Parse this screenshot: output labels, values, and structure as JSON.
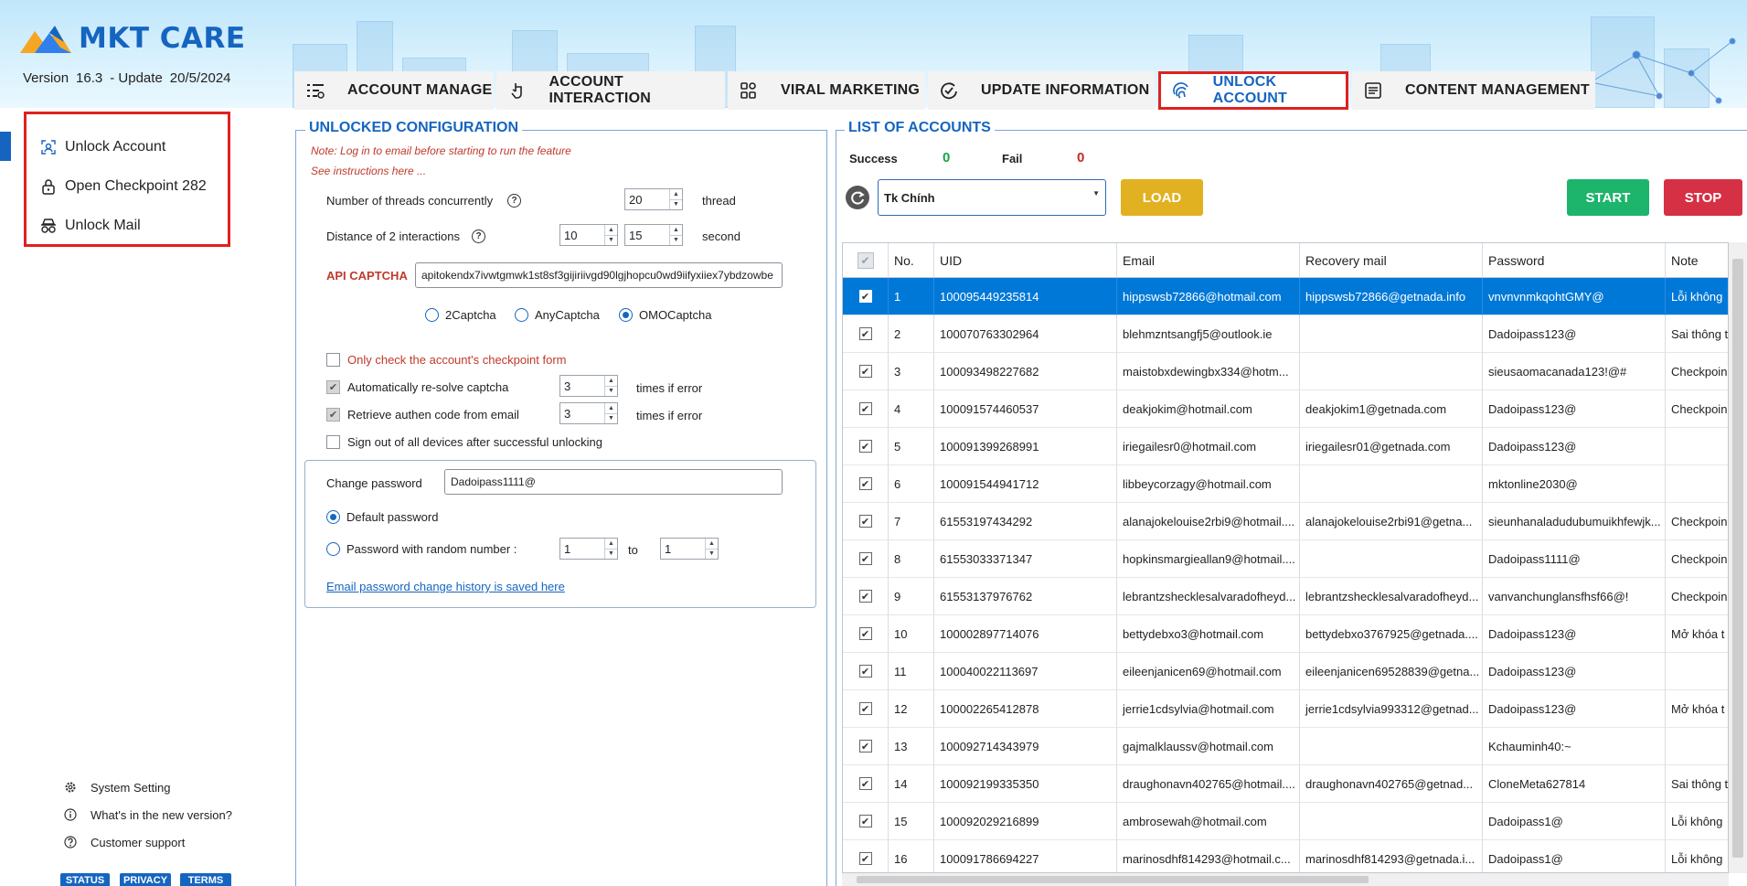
{
  "app": {
    "name": "MKT CARE",
    "version_label": "Version",
    "version": "16.3",
    "update_label": "- Update",
    "update_date": "20/5/2024"
  },
  "tabs": [
    {
      "label": "ACCOUNT MANAGE",
      "icon": "list-settings-icon"
    },
    {
      "label": "ACCOUNT INTERACTION",
      "icon": "hand-pointer-icon"
    },
    {
      "label": "VIRAL MARKETING",
      "icon": "grid-apps-icon"
    },
    {
      "label": "UPDATE INFORMATION",
      "icon": "refresh-check-icon"
    },
    {
      "label": "UNLOCK ACCOUNT",
      "icon": "fingerprint-icon",
      "active": true
    },
    {
      "label": "CONTENT MANAGEMENT",
      "icon": "document-icon"
    }
  ],
  "sidebar": {
    "items": [
      {
        "label": "Unlock Account",
        "icon": "scan-face-icon"
      },
      {
        "label": "Open Checkpoint 282",
        "icon": "lock-icon"
      },
      {
        "label": "Unlock Mail",
        "icon": "mail-spy-icon"
      }
    ],
    "footer": [
      {
        "label": "System Setting",
        "icon": "gear-icon"
      },
      {
        "label": "What's in the new version?",
        "icon": "info-icon"
      },
      {
        "label": "Customer support",
        "icon": "help-icon"
      }
    ],
    "footer_buttons": [
      "STATUS",
      "PRIVACY",
      "TERMS"
    ]
  },
  "config": {
    "title": "UNLOCKED CONFIGURATION",
    "note1": "Note: Log in to email before starting to run the feature",
    "note2": "See instructions here ...",
    "threads_label": "Number of threads concurrently",
    "threads_value": "20",
    "threads_unit": "thread",
    "distance_label": "Distance of 2 interactions",
    "distance_from": "10",
    "distance_to": "15",
    "distance_unit": "second",
    "api_label": "API CAPTCHA",
    "api_value": "apitokendx7ivwtgmwk1st8sf3gijiriivgd90lgjhopcu0wd9iifyxiiex7ybdzowbe",
    "captcha_options": [
      "2Captcha",
      "AnyCaptcha",
      "OMOCaptcha"
    ],
    "captcha_selected": "OMOCaptcha",
    "only_check_label": "Only check the account's checkpoint form",
    "resolve_label": "Automatically re-solve captcha",
    "resolve_value": "3",
    "resolve_unit": "times if error",
    "retrieve_label": "Retrieve authen code from email",
    "retrieve_value": "3",
    "retrieve_unit": "times if error",
    "signout_label": "Sign out of all devices after successful unlocking",
    "change_password_label": "Change password",
    "change_password_value": "Dadoipass1111@",
    "default_password_label": "Default password",
    "random_password_label": "Password with random number :",
    "random_from": "1",
    "random_to_label": "to",
    "random_to": "1",
    "history_link": "Email password change history is saved here"
  },
  "accounts": {
    "title": "LIST OF ACCOUNTS",
    "success_label": "Success",
    "success_value": "0",
    "fail_label": "Fail",
    "fail_value": "0",
    "combo_value": "Tk Chính",
    "load_label": "LOAD",
    "start_label": "START",
    "stop_label": "STOP",
    "colors": {
      "success": "#1aa34a",
      "fail": "#c62828",
      "load": "#e2b121",
      "start": "#1db46b",
      "stop": "#d63045",
      "accent": "#1565c0"
    },
    "columns": [
      "No.",
      "UID",
      "Email",
      "Recovery mail",
      "Password",
      "Note"
    ],
    "rows": [
      {
        "no": "1",
        "uid": "100095449235814",
        "email": "hippswsb72866@hotmail.com",
        "recovery": "hippswsb72866@getnada.info",
        "password": "vnvnvnmkqohtGMY@",
        "note": "Lỗi không"
      },
      {
        "no": "2",
        "uid": "100070763302964",
        "email": "blehmzntsangfj5@outlook.ie",
        "recovery": "",
        "password": "Dadoipass123@",
        "note": "Sai thông t"
      },
      {
        "no": "3",
        "uid": "100093498227682",
        "email": "maistobxdewingbx334@hotm...",
        "recovery": "",
        "password": "sieusaomacanada123!@#",
        "note": "Checkpoin"
      },
      {
        "no": "4",
        "uid": "100091574460537",
        "email": "deakjokim@hotmail.com",
        "recovery": "deakjokim1@getnada.com",
        "password": "Dadoipass123@",
        "note": "Checkpoin"
      },
      {
        "no": "5",
        "uid": "100091399268991",
        "email": "iriegailesr0@hotmail.com",
        "recovery": "iriegailesr01@getnada.com",
        "password": "Dadoipass123@",
        "note": ""
      },
      {
        "no": "6",
        "uid": "100091544941712",
        "email": "libbeycorzagy@hotmail.com",
        "recovery": "",
        "password": "mktonline2030@",
        "note": ""
      },
      {
        "no": "7",
        "uid": "61553197434292",
        "email": "alanajokelouise2rbi9@hotmail....",
        "recovery": "alanajokelouise2rbi91@getna...",
        "password": "sieunhanaladudubumuikhfewjk...",
        "note": "Checkpoin"
      },
      {
        "no": "8",
        "uid": "61553033371347",
        "email": "hopkinsmargieallan9@hotmail....",
        "recovery": "",
        "password": "Dadoipass1111@",
        "note": "Checkpoin"
      },
      {
        "no": "9",
        "uid": "61553137976762",
        "email": "lebrantzshecklesalvaradofheyd...",
        "recovery": "lebrantzshecklesalvaradofheyd...",
        "password": "vanvanchunglansfhsf66@!",
        "note": "Checkpoin"
      },
      {
        "no": "10",
        "uid": "100002897714076",
        "email": "bettydebxo3@hotmail.com",
        "recovery": "bettydebxo3767925@getnada....",
        "password": "Dadoipass123@",
        "note": "Mở khóa t"
      },
      {
        "no": "11",
        "uid": "100040022113697",
        "email": "eileenjanicen69@hotmail.com",
        "recovery": "eileenjanicen69528839@getna...",
        "password": "Dadoipass123@",
        "note": ""
      },
      {
        "no": "12",
        "uid": "100002265412878",
        "email": "jerrie1cdsylvia@hotmail.com",
        "recovery": "jerrie1cdsylvia993312@getnad...",
        "password": "Dadoipass123@",
        "note": "Mở khóa t"
      },
      {
        "no": "13",
        "uid": "100092714343979",
        "email": "gajmalklaussv@hotmail.com",
        "recovery": "",
        "password": "Kchauminh40:~",
        "note": ""
      },
      {
        "no": "14",
        "uid": "100092199335350",
        "email": "draughonavn402765@hotmail....",
        "recovery": "draughonavn402765@getnad...",
        "password": "CloneMeta627814",
        "note": "Sai thông t"
      },
      {
        "no": "15",
        "uid": "100092029216899",
        "email": "ambrosewah@hotmail.com",
        "recovery": "",
        "password": "Dadoipass1@",
        "note": "Lỗi không"
      },
      {
        "no": "16",
        "uid": "100091786694227",
        "email": "marinosdhf814293@hotmail.c...",
        "recovery": "marinosdhf814293@getnada.i...",
        "password": "Dadoipass1@",
        "note": "Lỗi không"
      }
    ]
  }
}
